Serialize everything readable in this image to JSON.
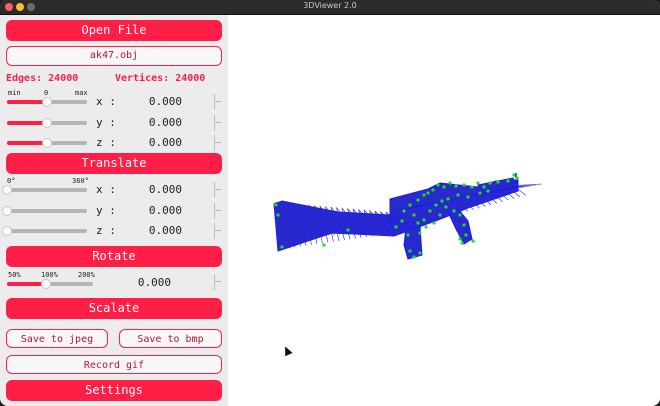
{
  "window": {
    "title": "3DViewer 2.0"
  },
  "buttons": {
    "open_file": "Open File",
    "translate": "Translate",
    "rotate": "Rotate",
    "scalate": "Scalate",
    "save_jpeg": "Save to jpeg",
    "save_bmp": "Save to bmp",
    "record_gif": "Record gif",
    "settings": "Settings"
  },
  "file": {
    "name": "ak47.obj"
  },
  "info": {
    "edges": "Edges: 24000",
    "vertices": "Vertices: 24000"
  },
  "translate": {
    "min_label": "min",
    "mid_label": "0",
    "max_label": "max",
    "rows": [
      {
        "axis": "x :",
        "value": "0.000",
        "slider_fraction": 0.5
      },
      {
        "axis": "y :",
        "value": "0.000",
        "slider_fraction": 0.5
      },
      {
        "axis": "z :",
        "value": "0.000",
        "slider_fraction": 0.5
      }
    ]
  },
  "rotate": {
    "min_label": "0°",
    "max_label": "360°",
    "rows": [
      {
        "axis": "x :",
        "value": "0.000",
        "slider_fraction": 0.0
      },
      {
        "axis": "y :",
        "value": "0.000",
        "slider_fraction": 0.0
      },
      {
        "axis": "z :",
        "value": "0.000",
        "slider_fraction": 0.0
      }
    ]
  },
  "scale": {
    "min_label": "50%",
    "mid_label": "100%",
    "max_label": "200%",
    "value": "0.000",
    "slider_fraction": 0.45
  },
  "colors": {
    "accent": "#ff1e46",
    "edges": "#1e1ee6",
    "vertices": "#14e614"
  }
}
